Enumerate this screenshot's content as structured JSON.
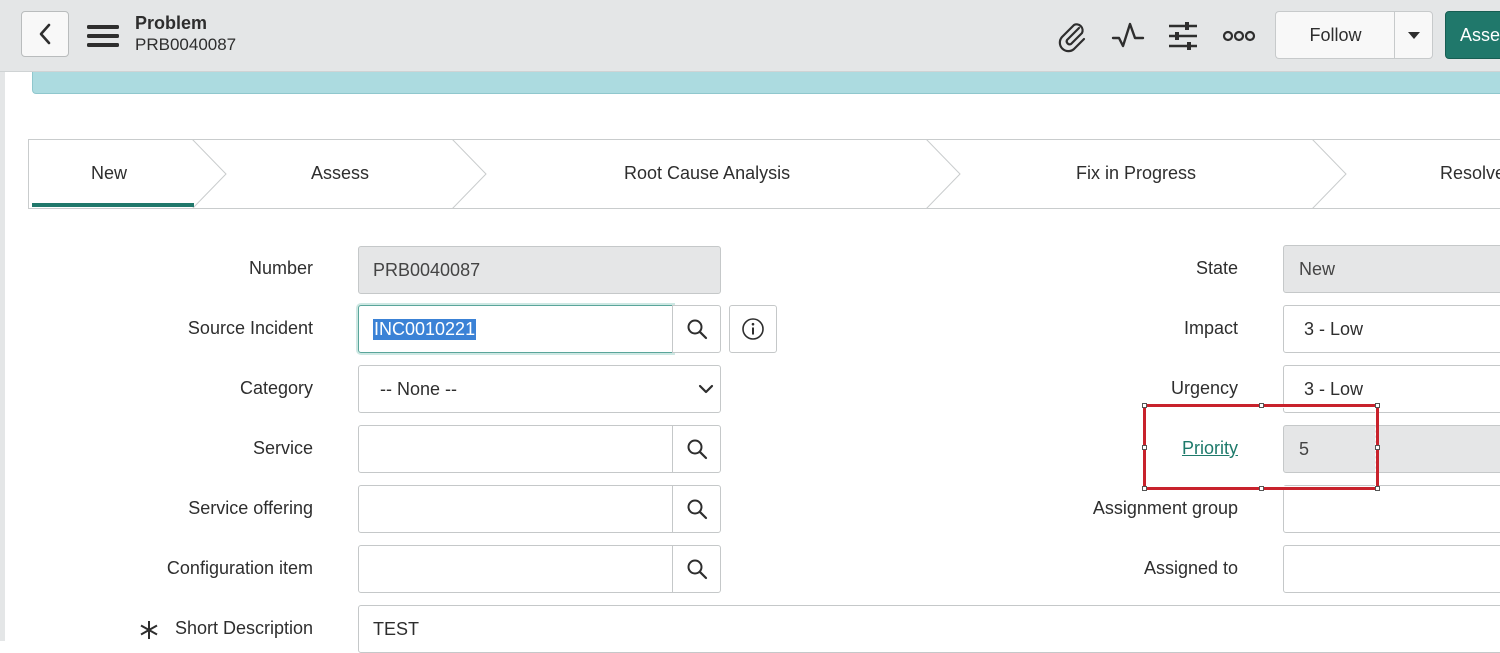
{
  "header": {
    "title": "Problem",
    "subtitle": "PRB0040087",
    "follow_label": "Follow",
    "primary_action_label": "Assess",
    "icons": [
      "back-arrow-icon",
      "hamburger-menu-icon",
      "paperclip-icon",
      "activity-pulse-icon",
      "sliders-icon",
      "more-options-icon",
      "caret-down-icon"
    ]
  },
  "flow": {
    "stages": [
      "New",
      "Assess",
      "Root Cause Analysis",
      "Fix in Progress",
      "Resolve"
    ],
    "active_stage": "New"
  },
  "form": {
    "left": {
      "number_label": "Number",
      "number_value": "PRB0040087",
      "source_incident_label": "Source Incident",
      "source_incident_value": "INC0010221",
      "category_label": "Category",
      "category_value": "-- None --",
      "service_label": "Service",
      "service_value": "",
      "service_offering_label": "Service offering",
      "service_offering_value": "",
      "configuration_item_label": "Configuration item",
      "configuration_item_value": "",
      "short_description_label": "Short Description",
      "short_description_value": "TEST"
    },
    "right": {
      "state_label": "State",
      "state_value": "New",
      "impact_label": "Impact",
      "impact_value": "3 - Low",
      "urgency_label": "Urgency",
      "urgency_value": "3 - Low",
      "priority_label": "Priority",
      "priority_value": "5",
      "assignment_group_label": "Assignment group",
      "assignment_group_value": "",
      "assigned_to_label": "Assigned to",
      "assigned_to_value": ""
    }
  },
  "colors": {
    "accent": "#20786b",
    "banner": "#acdbe0",
    "highlight_box": "#c8222c",
    "link": "#1e7a6b"
  }
}
